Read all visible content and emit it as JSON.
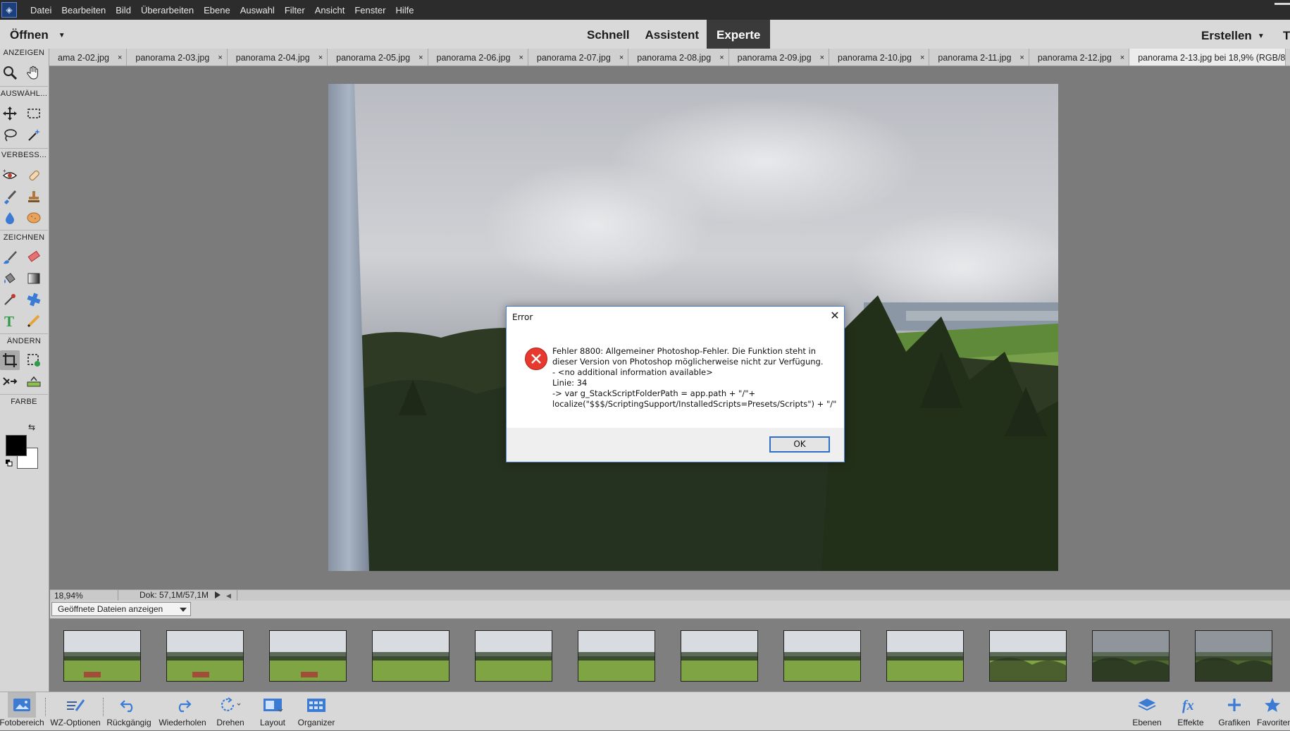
{
  "menubar": {
    "items": [
      "Datei",
      "Bearbeiten",
      "Bild",
      "Überarbeiten",
      "Ebene",
      "Auswahl",
      "Filter",
      "Ansicht",
      "Fenster",
      "Hilfe"
    ]
  },
  "modebar": {
    "open_label": "Öffnen",
    "modes": [
      "Schnell",
      "Assistent",
      "Experte"
    ],
    "active_mode": "Experte",
    "create_label": "Erstellen",
    "extra_label": "T"
  },
  "tabs": [
    {
      "label": "ama 2-02.jpg",
      "active": false
    },
    {
      "label": "panorama 2-03.jpg",
      "active": false
    },
    {
      "label": "panorama 2-04.jpg",
      "active": false
    },
    {
      "label": "panorama 2-05.jpg",
      "active": false
    },
    {
      "label": "panorama 2-06.jpg",
      "active": false
    },
    {
      "label": "panorama 2-07.jpg",
      "active": false
    },
    {
      "label": "panorama 2-08.jpg",
      "active": false
    },
    {
      "label": "panorama 2-09.jpg",
      "active": false
    },
    {
      "label": "panorama 2-10.jpg",
      "active": false
    },
    {
      "label": "panorama 2-11.jpg",
      "active": false
    },
    {
      "label": "panorama 2-12.jpg",
      "active": false
    },
    {
      "label": "panorama 2-13.jpg bei 18,9% (RGB/8",
      "active": true
    }
  ],
  "toolbox": {
    "sections": {
      "view": "ANZEIGEN",
      "select": "AUSWÄHL...",
      "enhance": "VERBESS...",
      "draw": "ZEICHNEN",
      "modify": "ÄNDERN",
      "color": "FARBE"
    },
    "foreground_color": "#000000",
    "background_color": "#ffffff"
  },
  "status": {
    "zoom": "18,94%",
    "doc": "Dok: 57,1M/57,1M"
  },
  "photo_bin": {
    "select_label": "Geöffnete Dateien anzeigen",
    "thumb_count": 12
  },
  "taskbar": {
    "left": [
      "Fotobereich",
      "WZ-Optionen",
      "Rückgängig",
      "Wiederholen",
      "Drehen",
      "Layout",
      "Organizer"
    ],
    "right": [
      "Ebenen",
      "Effekte",
      "Grafiken",
      "Favoriten"
    ]
  },
  "dialog": {
    "title": "Error",
    "message": "Fehler 8800: Allgemeiner Photoshop-Fehler. Die Funktion steht in dieser Version von Photoshop möglicherweise nicht zur Verfügung.\n- <no additional information available>\nLinie: 34\n->  var g_StackScriptFolderPath = app.path + \"/\"+ localize(\"$$$/ScriptingSupport/InstalledScripts=Presets/Scripts\") + \"/\"",
    "ok_label": "OK",
    "accent": "#2f6fc9",
    "error_color": "#e63a2e"
  }
}
